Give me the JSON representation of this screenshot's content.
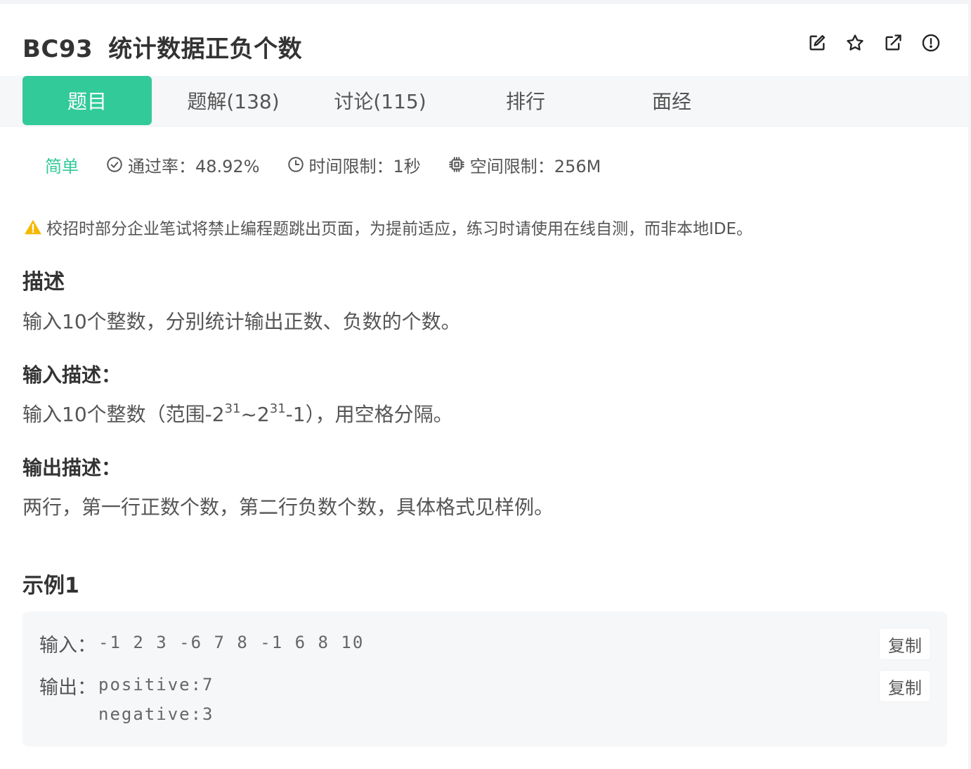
{
  "header": {
    "code": "BC93",
    "title": "统计数据正负个数",
    "actions": [
      {
        "name": "edit-icon"
      },
      {
        "name": "star-icon"
      },
      {
        "name": "share-icon"
      },
      {
        "name": "report-icon"
      }
    ]
  },
  "tabs": [
    {
      "label": "题目",
      "active": true
    },
    {
      "label": "题解(138)",
      "active": false
    },
    {
      "label": "讨论(115)",
      "active": false
    },
    {
      "label": "排行",
      "active": false
    },
    {
      "label": "面经",
      "active": false
    }
  ],
  "meta": {
    "difficulty": "简单",
    "pass_rate": "通过率：48.92%",
    "time_limit": "时间限制：1秒",
    "memory_limit": "空间限制：256M"
  },
  "warning": "校招时部分企业笔试将禁止编程题跳出页面，为提前适应，练习时请使用在线自测，而非本地IDE。",
  "description": {
    "heading": "描述",
    "text": "输入10个整数，分别统计输出正数、负数的个数。"
  },
  "input_desc": {
    "heading": "输入描述：",
    "prefix": "输入10个整数（范围-2",
    "exp1": "31",
    "mid": "~2",
    "exp2": "31",
    "suffix": "-1），用空格分隔。"
  },
  "output_desc": {
    "heading": "输出描述：",
    "text": "两行，第一行正数个数，第二行负数个数，具体格式见样例。"
  },
  "example": {
    "heading": "示例1",
    "input_label": "输入：",
    "input_value": "-1 2 3 -6 7 8 -1 6 8 10",
    "output_label": "输出：",
    "output_line1": "positive:7",
    "output_line2": "negative:3",
    "copy_label": "复制"
  },
  "colors": {
    "accent": "#32ca99",
    "warning": "#f5b800"
  }
}
